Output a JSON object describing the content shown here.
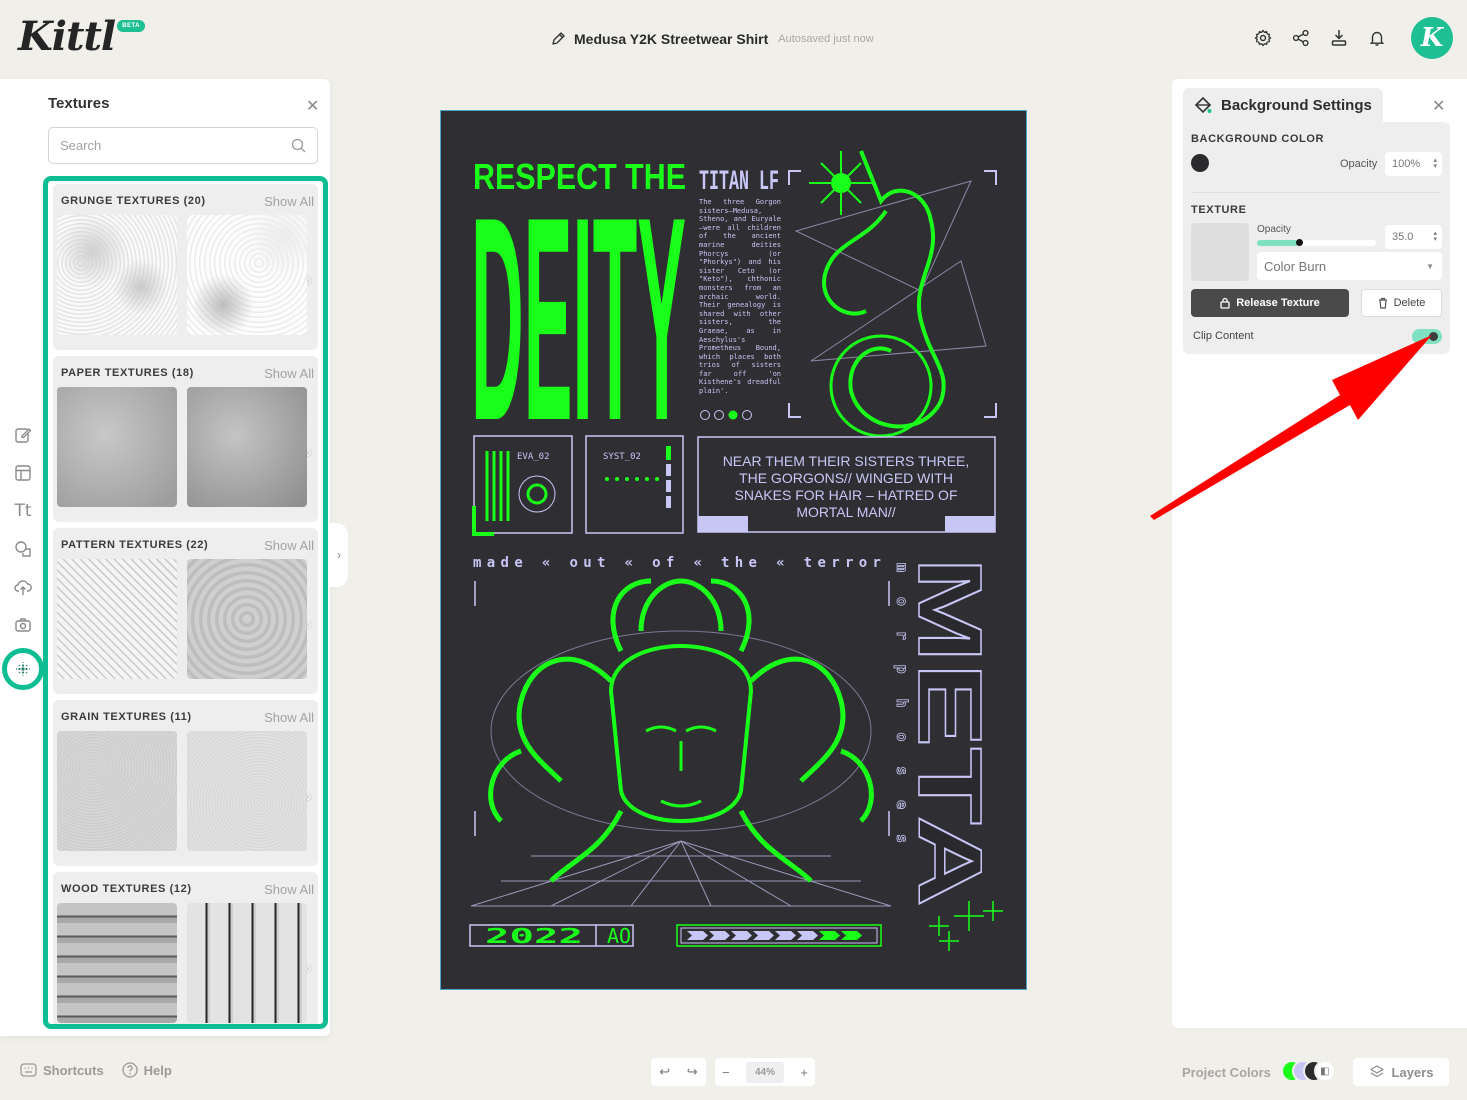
{
  "app": {
    "logo": "Kittl",
    "beta_badge": "BETA"
  },
  "header": {
    "doc_title": "Medusa Y2K Streetwear Shirt",
    "autosave_status": "Autosaved just now",
    "icons": [
      "settings-icon",
      "share-icon",
      "download-icon",
      "bell-icon"
    ],
    "avatar_initial": "K"
  },
  "tool_rail": {
    "items": [
      {
        "name": "edit",
        "icon": "edit-icon"
      },
      {
        "name": "templates",
        "icon": "layout-icon"
      },
      {
        "name": "text",
        "icon": "text-icon",
        "glyph": "Tt"
      },
      {
        "name": "shapes",
        "icon": "shapes-icon"
      },
      {
        "name": "uploads",
        "icon": "upload-icon"
      },
      {
        "name": "photos",
        "icon": "camera-icon"
      },
      {
        "name": "textures",
        "icon": "texture-icon",
        "active": true
      }
    ]
  },
  "textures_panel": {
    "title": "Textures",
    "search_placeholder": "Search",
    "show_all_label": "Show All",
    "categories": [
      {
        "name": "GRUNGE TEXTURES (20)"
      },
      {
        "name": "PAPER TEXTURES (18)"
      },
      {
        "name": "PATTERN TEXTURES (22)"
      },
      {
        "name": "GRAIN TEXTURES (11)"
      },
      {
        "name": "WOOD TEXTURES (12)"
      }
    ]
  },
  "artwork": {
    "headline_top": "RESPECT THE",
    "headline_main": "DEITY",
    "tag_right": "TITAN LF",
    "body_text": "The three Gorgon sisters—Medusa, Stheno, and Euryale—were all children of the ancient marine deities Phorcys (or \"Phorkys\") and his sister Ceto (or \"Keto\"), chthonic monsters from an archaic world. Their genealogy is shared with other sisters, the Graeae, as in Aeschylus's Prometheus Bound, which places both trios of sisters far off 'on Kisthene's dreadful plain'.",
    "panel_eva": "EVA_02",
    "panel_syst": "SYST_02",
    "quote": [
      "NEAR THEM THEIR SISTERS THREE,",
      "THE GORGONS// WINGED WITH",
      "SNAKES FOR HAIR – HATRED OF",
      "MORTAL MAN//"
    ],
    "tagline": "made « out « of « the « terror",
    "vertical_small": "morphoses",
    "vertical_big": "META",
    "year": "2022",
    "code": "AO",
    "accent": "#19ff19",
    "lavender": "#c8c6f5",
    "bg": "#2f2f33"
  },
  "background_settings": {
    "title": "Background Settings",
    "bg_color_label": "BACKGROUND COLOR",
    "bg_color": "#2b2b2e",
    "opacity_label": "Opacity",
    "bg_opacity": "100%",
    "texture_label": "TEXTURE",
    "texture_opacity_label": "Opacity",
    "texture_opacity": "35.0",
    "texture_opacity_fraction": 0.35,
    "blend_mode": "Color Burn",
    "release_label": "Release Texture",
    "delete_label": "Delete",
    "clip_label": "Clip Content",
    "clip_enabled": true
  },
  "footer": {
    "shortcuts_label": "Shortcuts",
    "help_label": "Help",
    "zoom_value": "44%",
    "project_colors_label": "Project Colors",
    "project_colors": [
      "#19ff19",
      "#c8c6f5",
      "#2b2b2e"
    ],
    "layers_label": "Layers"
  },
  "annotation": {
    "arrow_color": "#ff0000",
    "points_to": "clip-content-toggle"
  }
}
